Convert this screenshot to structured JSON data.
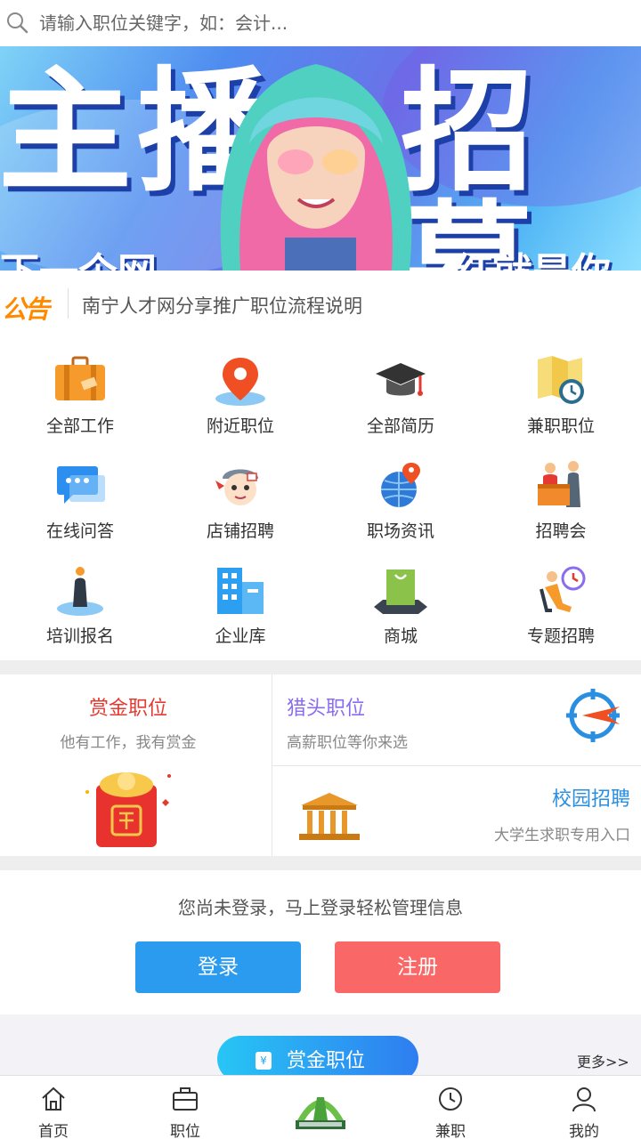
{
  "search": {
    "placeholder": "请输入职位关键字，如：会计..."
  },
  "banner": {
    "title_left": "主播",
    "title_right": "招募",
    "sub_left": "下一个网",
    "sub_right": "红就是你"
  },
  "notice": {
    "tag": "公告",
    "text": "南宁人才网分享推广职位流程说明"
  },
  "grid": [
    {
      "label": "全部工作",
      "icon": "briefcase-icon"
    },
    {
      "label": "附近职位",
      "icon": "location-pin-icon"
    },
    {
      "label": "全部简历",
      "icon": "graduation-cap-icon"
    },
    {
      "label": "兼职职位",
      "icon": "map-clock-icon"
    },
    {
      "label": "在线问答",
      "icon": "chat-bubble-icon"
    },
    {
      "label": "店铺招聘",
      "icon": "shop-mascot-icon"
    },
    {
      "label": "职场资讯",
      "icon": "globe-pin-icon"
    },
    {
      "label": "招聘会",
      "icon": "job-fair-icon"
    },
    {
      "label": "培训报名",
      "icon": "person-podium-icon"
    },
    {
      "label": "企业库",
      "icon": "buildings-icon"
    },
    {
      "label": "商城",
      "icon": "shopping-bag-icon"
    },
    {
      "label": "专题招聘",
      "icon": "person-clock-icon"
    }
  ],
  "promo": {
    "bounty": {
      "title": "赏金职位",
      "subtitle": "他有工作，我有赏金"
    },
    "headhunter": {
      "title": "猎头职位",
      "subtitle": "高薪职位等你来选"
    },
    "campus": {
      "title": "校园招聘",
      "subtitle": "大学生求职专用入口"
    }
  },
  "login": {
    "message": "您尚未登录，马上登录轻松管理信息",
    "login_label": "登录",
    "register_label": "注册"
  },
  "section": {
    "pill_label": "赏金职位",
    "more_label": "更多>>"
  },
  "tabbar": [
    {
      "label": "首页",
      "icon": "home-icon"
    },
    {
      "label": "职位",
      "icon": "briefcase-icon"
    },
    {
      "label": "",
      "icon": "site-logo-icon"
    },
    {
      "label": "兼职",
      "icon": "clock-icon"
    },
    {
      "label": "我的",
      "icon": "user-icon"
    }
  ],
  "colors": {
    "accent_blue": "#2b9bef",
    "register_red": "#f96767",
    "bounty_red": "#e53a32",
    "headhunter_purple": "#8a6cf0",
    "campus_blue": "#2a8fe0",
    "notice_orange": "#ff8a00"
  }
}
